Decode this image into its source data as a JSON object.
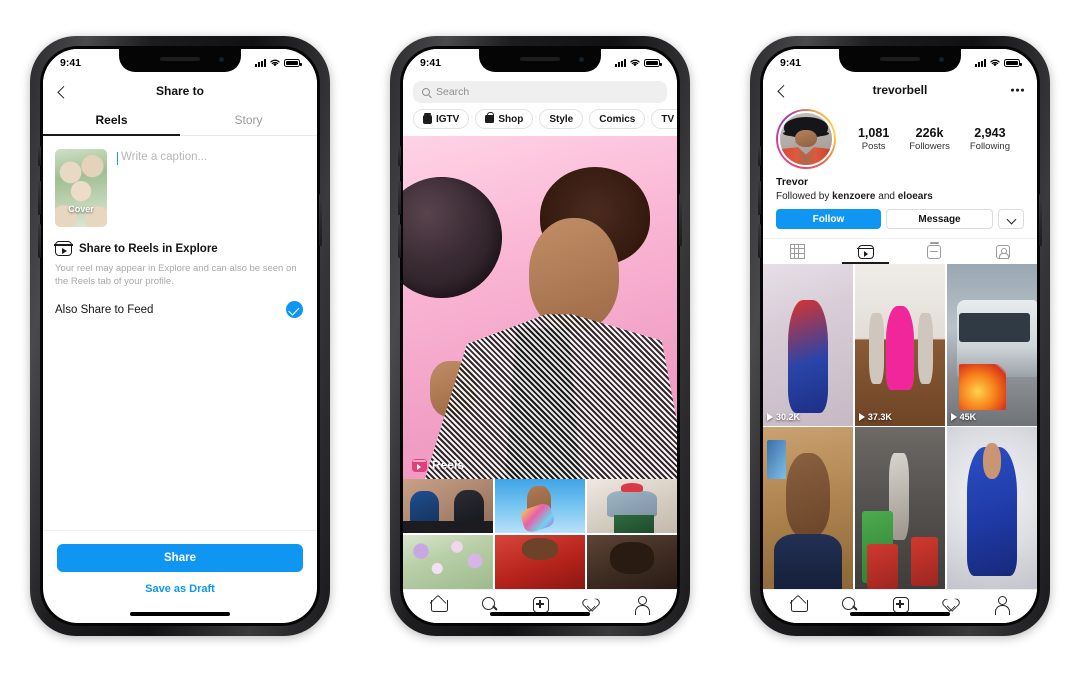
{
  "phones": {
    "phone1": {
      "status": {
        "time": "9:41"
      },
      "nav": {
        "title": "Share to",
        "back_icon": "chevron-left-icon"
      },
      "tabs": [
        {
          "label": "Reels",
          "active": true
        },
        {
          "label": "Story",
          "active": false
        }
      ],
      "compose": {
        "cover_label": "Cover",
        "caption_placeholder": "Write a caption..."
      },
      "explore": {
        "icon": "reels-icon",
        "title": "Share to Reels in Explore",
        "description": "Your reel may appear in Explore and can also be seen on the Reels tab of your profile."
      },
      "feed_toggle": {
        "label": "Also Share to Feed",
        "checked": true
      },
      "footer": {
        "share_label": "Share",
        "draft_label": "Save as Draft"
      }
    },
    "phone2": {
      "status": {
        "time": "9:41"
      },
      "search": {
        "placeholder": "Search",
        "icon": "search-icon"
      },
      "chips": [
        {
          "label": "IGTV",
          "icon": "igtv-icon"
        },
        {
          "label": "Shop",
          "icon": "shopping-bag-icon"
        },
        {
          "label": "Style",
          "icon": ""
        },
        {
          "label": "Comics",
          "icon": ""
        },
        {
          "label": "TV & Movies",
          "icon": ""
        }
      ],
      "hero": {
        "badge_label": "Reels",
        "badge_icon": "reels-icon"
      },
      "navbar": [
        {
          "name": "home",
          "icon": "home-icon"
        },
        {
          "name": "search",
          "icon": "search-icon"
        },
        {
          "name": "create",
          "icon": "plus-square-icon"
        },
        {
          "name": "activity",
          "icon": "heart-icon"
        },
        {
          "name": "profile",
          "icon": "person-icon"
        }
      ]
    },
    "phone3": {
      "status": {
        "time": "9:41"
      },
      "nav": {
        "username": "trevorbell",
        "back_icon": "chevron-left-icon",
        "more_icon": "more-dots-icon"
      },
      "stats": [
        {
          "value": "1,081",
          "label": "Posts"
        },
        {
          "value": "226k",
          "label": "Followers"
        },
        {
          "value": "2,943",
          "label": "Following"
        }
      ],
      "bio": {
        "display_name": "Trevor",
        "followed_by_prefix": "Followed by ",
        "followed_by_user1": "kenzoere",
        "followed_by_join": " and ",
        "followed_by_user2": "eloears"
      },
      "actions": {
        "follow_label": "Follow",
        "message_label": "Message",
        "more_icon": "chevron-down-icon"
      },
      "tabs": [
        {
          "name": "grid",
          "icon": "grid-icon",
          "active": false
        },
        {
          "name": "reels",
          "icon": "reels-icon",
          "active": true
        },
        {
          "name": "igtv",
          "icon": "igtv-icon",
          "active": false
        },
        {
          "name": "tagged",
          "icon": "tagged-person-icon",
          "active": false
        }
      ],
      "grid": [
        {
          "views": "30.2K",
          "art": "art-spider"
        },
        {
          "views": "37.3K",
          "art": "art-dance"
        },
        {
          "views": "45K",
          "art": "art-bus"
        },
        {
          "views": "",
          "art": "art-teen"
        },
        {
          "views": "",
          "art": "art-gym"
        },
        {
          "views": "",
          "art": "art-super"
        }
      ],
      "navbar": [
        {
          "name": "home",
          "icon": "home-icon"
        },
        {
          "name": "search",
          "icon": "search-icon"
        },
        {
          "name": "create",
          "icon": "plus-square-icon"
        },
        {
          "name": "activity",
          "icon": "heart-icon"
        },
        {
          "name": "profile",
          "icon": "person-icon"
        }
      ]
    }
  },
  "colors": {
    "accent_blue": "#0f96f2",
    "reels_pink": "#e0417a",
    "text_primary": "#141414",
    "text_muted": "#8e8e8e",
    "phone_frame": "#1d1d1f"
  }
}
